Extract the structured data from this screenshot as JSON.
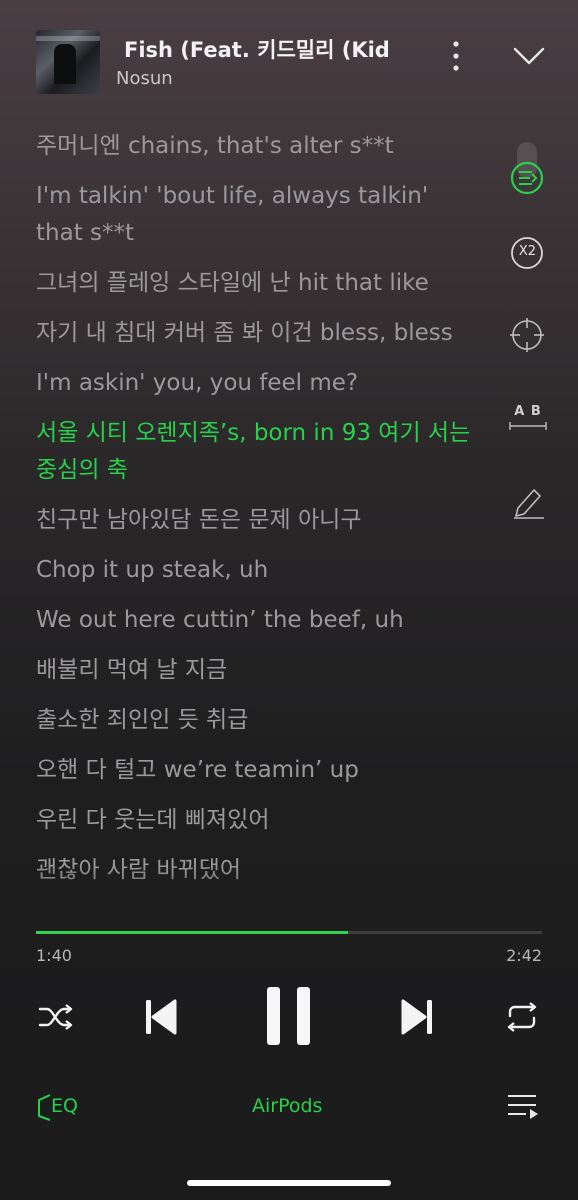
{
  "now_playing": {
    "title": "Fish (Feat. 키드밀리 (Kid",
    "artist": "Nosun"
  },
  "lyrics": [
    {
      "text": "주머니엔 chains, that's alter s**t",
      "active": false
    },
    {
      "text": "I'm talkin' 'bout life, always talkin' that s**t",
      "active": false
    },
    {
      "text": "그녀의 플레잉 스타일에 난 hit that like",
      "active": false
    },
    {
      "text": "자기 내 침대 커버 좀 봐 이건 bless, bless",
      "active": false
    },
    {
      "text": "I'm askin' you, you feel me?",
      "active": false
    },
    {
      "text": "서울 시티 오렌지족’s, born in 93 여기 서는 중심의 축",
      "active": true
    },
    {
      "text": "친구만 남아있담 돈은 문제 아니구",
      "active": false
    },
    {
      "text": "Chop it up steak, uh",
      "active": false
    },
    {
      "text": "We out here cuttin’ the beef, uh",
      "active": false
    },
    {
      "text": "배불리 먹여 날 지금",
      "active": false
    },
    {
      "text": "출소한 죄인인 듯 취급",
      "active": false
    },
    {
      "text": "오핸 다 털고 we’re teamin’ up",
      "active": false
    },
    {
      "text": "우린 다 웃는데 삐져있어",
      "active": false
    },
    {
      "text": "괜찮아 사람 바뀌댔어",
      "active": false
    }
  ],
  "side_tools": {
    "speed_label": "X2",
    "translate_label": "A B"
  },
  "playback": {
    "elapsed": "1:40",
    "duration": "2:42",
    "progress_fraction": 0.6173
  },
  "bottom_bar": {
    "eq_label": "EQ",
    "output_device": "AirPods"
  },
  "colors": {
    "accent": "#27d14a",
    "lyric_inactive": "#9b999b"
  }
}
